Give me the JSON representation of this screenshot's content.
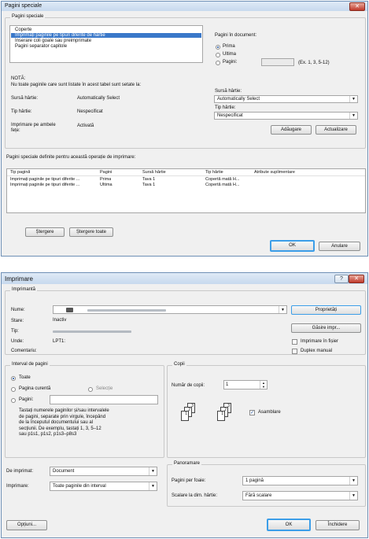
{
  "dialog1": {
    "title": "Pagini speciale",
    "group_title": "Pagini speciale",
    "list_items": [
      "Coperte",
      "Imprimați paginile pe tipuri diferite de hârtie",
      "Inserare coli goale sau preimprimate",
      "Pagini separator capitole"
    ],
    "list_selected": 1,
    "pages_in_doc_label": "Pagini în document:",
    "radio_options": [
      "Prima",
      "Ultima",
      "Pagini:"
    ],
    "radio_selected": 0,
    "pages_example": "(Ex. 1, 3, 5-12)",
    "note_title": "NOTĂ:",
    "note_text": "Nu toate paginile care sunt listate în acest tabel sunt setate la:",
    "settings": [
      {
        "label": "Sursă hârtie:",
        "value": "Automatically Select"
      },
      {
        "label": "Tip hârtie:",
        "value": "Nespecificat"
      },
      {
        "label": "Imprimare pe ambele fețe:",
        "value": "Activată"
      }
    ],
    "source_label": "Sursă hârtie:",
    "source_value": "Automatically Select",
    "type_label": "Tip hârtie:",
    "type_value": "Nespecificat",
    "add_label": "Adăugare",
    "update_label": "Actualizare",
    "defined_label": "Pagini speciale definite pentru această operație de imprimare:",
    "table_headers": [
      "Tip pagină",
      "Pagini",
      "Sursă hârtie",
      "Tip hârtie",
      "Atribute suplimentare"
    ],
    "table_rows": [
      [
        "Imprimați paginile pe tipuri diferite ...",
        "Prima",
        "Tava 1",
        "Copertă mată H...",
        ""
      ],
      [
        "Imprimați paginile pe tipuri diferite ...",
        "Ultima",
        "Tava 1",
        "Copertă mată H...",
        ""
      ]
    ],
    "delete_label": "Ștergere",
    "delete_all_label": "Ștergere toate",
    "ok_label": "OK",
    "cancel_label": "Anulare"
  },
  "dialog2": {
    "title": "Imprimare",
    "printer_group": "Imprimantă",
    "name_label": "Nume:",
    "status_label": "Stare:",
    "status_value": "Inactiv",
    "type_label": "Tip:",
    "where_label": "Unde:",
    "where_value": "LPT1:",
    "comment_label": "Comentariu:",
    "properties_label": "Proprietăți",
    "find_label": "Găsire impr...",
    "print_to_file_label": "Imprimare în fișier",
    "manual_duplex_label": "Duplex manual",
    "range_group": "Interval de pagini",
    "range_all": "Toate",
    "range_current": "Pagina curentă",
    "range_selection": "Selecție",
    "range_pages": "Pagini:",
    "range_help": [
      "Tastați numerele paginilor și/sau intervalele",
      "de pagini, separate prin virgule, începând",
      "de la începutul documentului sau al",
      "secțiunii. De exemplu, tastați 1, 3, 5–12",
      "sau p1s1, p1s2, p1s3–p8s3"
    ],
    "copies_group": "Copii",
    "copies_label": "Număr de copii:",
    "copies_value": "1",
    "collate_label": "Asamblare",
    "page_numbers": [
      "3",
      "2",
      "1",
      "3",
      "2",
      "1"
    ],
    "print_what_label": "De imprimat:",
    "print_what_value": "Document",
    "print_label": "Imprimare:",
    "print_value": "Toate paginile din interval",
    "zoom_group": "Panoramare",
    "pages_per_sheet_label": "Pagini per foaie:",
    "pages_per_sheet_value": "1 pagină",
    "scale_label": "Scalare la dim. hârtie:",
    "scale_value": "Fără scalare",
    "options_label": "Opțiuni...",
    "ok_label": "OK",
    "close_label": "Închidere"
  }
}
